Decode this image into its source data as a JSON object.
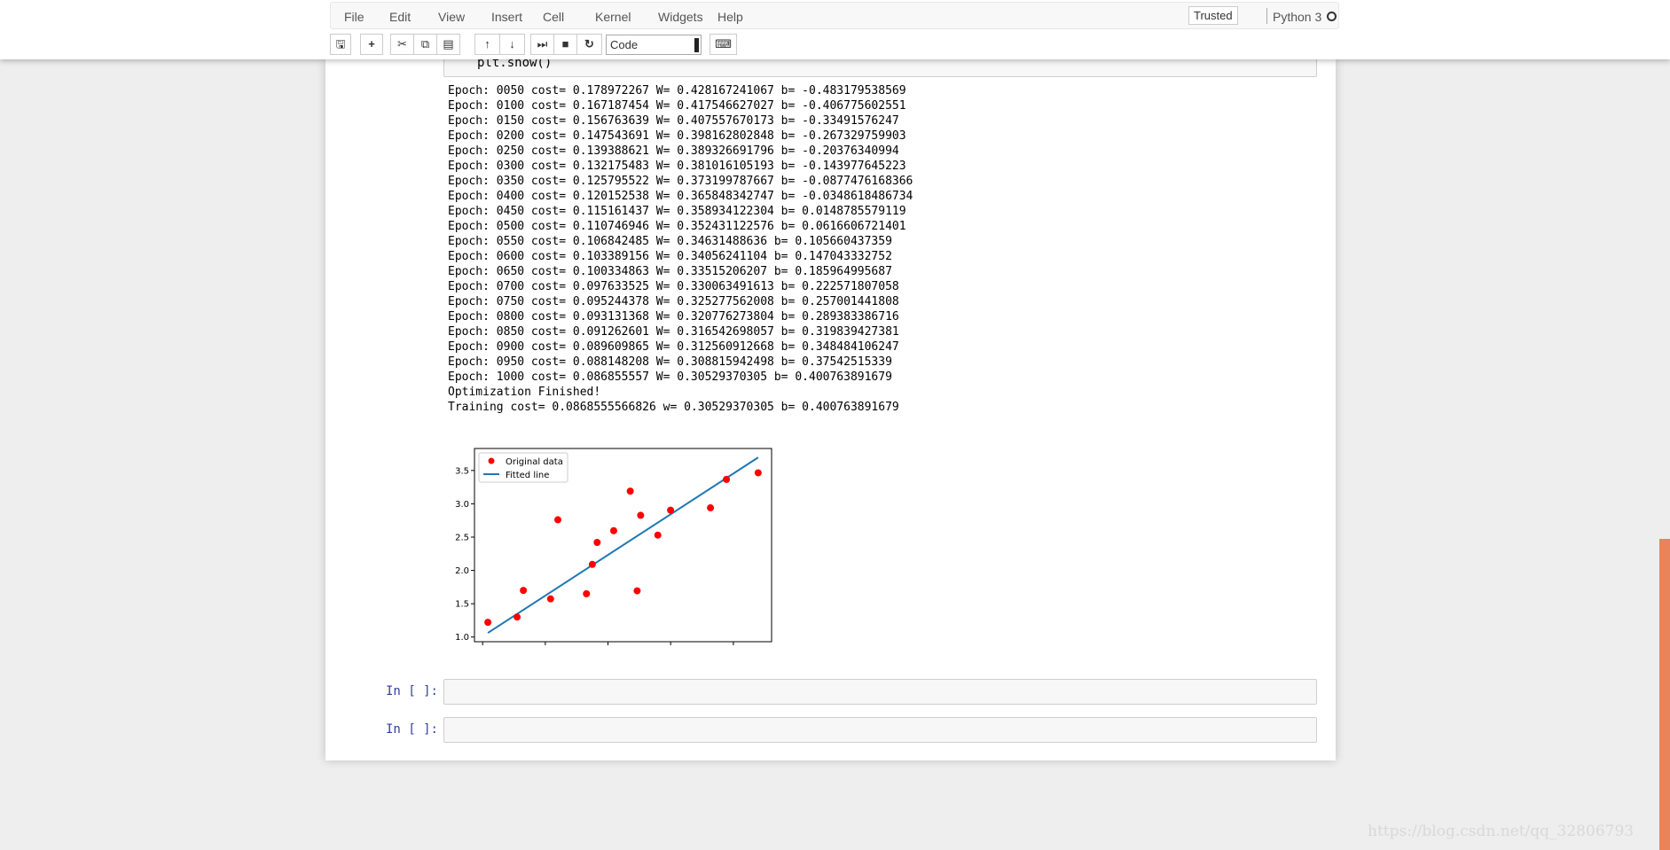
{
  "menu": {
    "items": [
      "File",
      "Edit",
      "View",
      "Insert",
      "Cell",
      "Kernel",
      "Widgets",
      "Help"
    ],
    "trusted": "Trusted",
    "kernel": "Python 3"
  },
  "toolbar": {
    "cell_type": "Code",
    "icons": [
      "save-icon",
      "plus-icon",
      "cut-icon",
      "copy-icon",
      "paste-icon",
      "arrow-up-icon",
      "arrow-down-icon",
      "step-forward-icon",
      "stop-icon",
      "restart-icon",
      "keyboard-icon"
    ]
  },
  "cell_prev": {
    "code": "    plt.show()"
  },
  "output_lines": [
    "Epoch: 0050 cost= 0.178972267 W= 0.428167241067 b= -0.483179538569",
    "Epoch: 0100 cost= 0.167187454 W= 0.417546627027 b= -0.406775602551",
    "Epoch: 0150 cost= 0.156763639 W= 0.407557670173 b= -0.33491576247",
    "Epoch: 0200 cost= 0.147543691 W= 0.398162802848 b= -0.267329759903",
    "Epoch: 0250 cost= 0.139388621 W= 0.389326691796 b= -0.20376340994",
    "Epoch: 0300 cost= 0.132175483 W= 0.381016105193 b= -0.143977645223",
    "Epoch: 0350 cost= 0.125795522 W= 0.373199787667 b= -0.0877476168366",
    "Epoch: 0400 cost= 0.120152538 W= 0.365848342747 b= -0.0348618486734",
    "Epoch: 0450 cost= 0.115161437 W= 0.358934122304 b= 0.0148785579119",
    "Epoch: 0500 cost= 0.110746946 W= 0.352431122576 b= 0.0616606721401",
    "Epoch: 0550 cost= 0.106842485 W= 0.34631488636 b= 0.105660437359",
    "Epoch: 0600 cost= 0.103389156 W= 0.34056241104 b= 0.147043332752",
    "Epoch: 0650 cost= 0.100334863 W= 0.33515206207 b= 0.185964995687",
    "Epoch: 0700 cost= 0.097633525 W= 0.330063491613 b= 0.222571807058",
    "Epoch: 0750 cost= 0.095244378 W= 0.325277562008 b= 0.257001441808",
    "Epoch: 0800 cost= 0.093131368 W= 0.320776273804 b= 0.289383386716",
    "Epoch: 0850 cost= 0.091262601 W= 0.316542698057 b= 0.319839427381",
    "Epoch: 0900 cost= 0.089609865 W= 0.312560912668 b= 0.348484106247",
    "Epoch: 0950 cost= 0.088148208 W= 0.308815942498 b= 0.37542515339",
    "Epoch: 1000 cost= 0.086855557 W= 0.30529370305 b= 0.400763891679",
    "Optimization Finished!",
    "Training cost= 0.0868555566826 w= 0.30529370305 b= 0.400763891679"
  ],
  "chart_data": {
    "type": "scatter",
    "xlim": [
      1.74,
      11.22
    ],
    "ylim": [
      0.93,
      3.83
    ],
    "xticks": [
      "2",
      "4",
      "6",
      "8",
      "10"
    ],
    "yticks": [
      "1.0",
      "1.5",
      "2.0",
      "2.5",
      "3.0",
      "3.5"
    ],
    "legend": "top-left",
    "grid": false,
    "series": [
      {
        "name": "Original data",
        "kind": "points",
        "color": "#ff0000",
        "x": [
          3.3,
          4.4,
          5.5,
          6.71,
          6.93,
          4.168,
          9.779,
          6.182,
          7.59,
          2.167,
          7.042,
          10.791,
          5.313,
          7.997,
          5.654,
          9.27,
          3.1
        ],
        "y": [
          1.7,
          2.76,
          2.09,
          3.19,
          1.694,
          1.573,
          3.366,
          2.596,
          2.53,
          1.221,
          2.827,
          3.465,
          1.65,
          2.904,
          2.42,
          2.94,
          1.3
        ]
      },
      {
        "name": "Fitted line",
        "kind": "line",
        "color": "#1f77b4",
        "x": [
          2.167,
          10.791
        ],
        "y": [
          1.0623,
          3.6953
        ]
      }
    ]
  },
  "empty_cells": [
    {
      "prompt": "In [ ]:"
    },
    {
      "prompt": "In [ ]:"
    }
  ],
  "watermark": "https://blog.csdn.net/qq_32806793"
}
